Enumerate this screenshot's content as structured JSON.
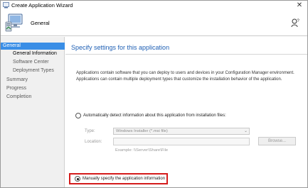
{
  "window": {
    "title": "Create Application Wizard",
    "close_glyph": "✕"
  },
  "header": {
    "title": "General",
    "icon": "computer-icon",
    "help_icon": "help-icon"
  },
  "nav": {
    "items": [
      {
        "label": "General",
        "level": 0,
        "active": true
      },
      {
        "label": "General Information",
        "level": 1,
        "current": true
      },
      {
        "label": "Software Center",
        "level": 1
      },
      {
        "label": "Deployment Types",
        "level": 1
      },
      {
        "label": "Summary",
        "level": 0
      },
      {
        "label": "Progress",
        "level": 0
      },
      {
        "label": "Completion",
        "level": 0
      }
    ]
  },
  "main": {
    "heading": "Specify settings for this application",
    "description_line1": "Applications contain software that you can deploy to users and devices in your Configuration Manager environment.",
    "description_line2": "Applications can contain multiple deployment types that customize the installation behavior of the application.",
    "auto_detect_label": "Automatically detect information about this application from installation files:",
    "auto_detect_checked": false,
    "type_label": "Type:",
    "type_value": "Windows Installer (*.msi file)",
    "location_label": "Location:",
    "location_value": "",
    "location_hint": "Example: \\\\Server\\Share\\File",
    "browse_label": "Browse...",
    "manual_label": "Manually specify the application information",
    "manual_checked": true
  },
  "colors": {
    "accent": "#3a8ee6",
    "heading": "#1e5fb4",
    "highlight": "#d41c1c"
  }
}
